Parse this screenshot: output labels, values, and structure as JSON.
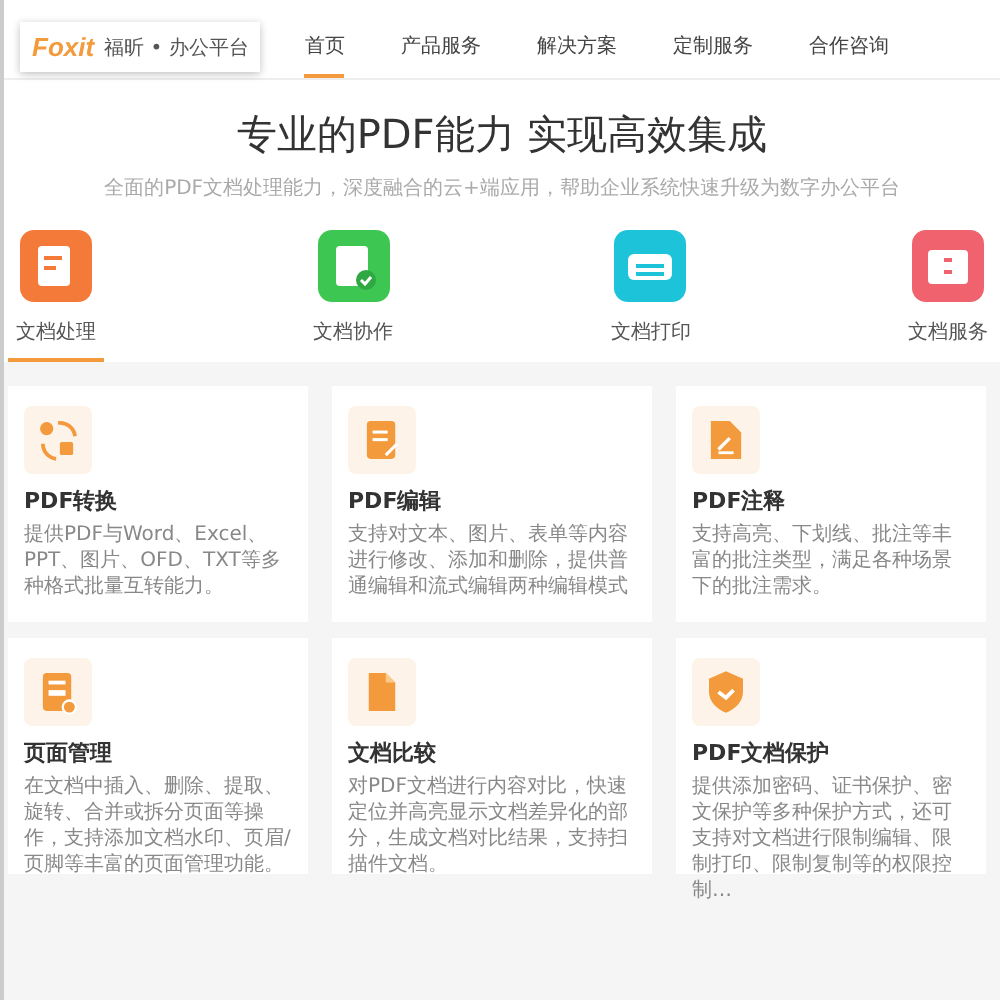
{
  "header": {
    "logo": "Foxit",
    "brand": "福昕 • 办公平台",
    "nav": [
      {
        "label": "首页",
        "selected": true
      },
      {
        "label": "产品服务",
        "selected": false
      },
      {
        "label": "解决方案",
        "selected": false
      },
      {
        "label": "定制服务",
        "selected": false
      },
      {
        "label": "合作咨询",
        "selected": false
      }
    ]
  },
  "hero": {
    "title": "专业的PDF能力 实现高效集成",
    "subtitle": "全面的PDF文档处理能力，深度融合的云+端应用，帮助企业系统快速升级为数字办公平台"
  },
  "tabs": [
    {
      "label": "文档处理",
      "selected": true,
      "color": "#f47a3a"
    },
    {
      "label": "文档协作",
      "selected": false,
      "color": "#3ec653"
    },
    {
      "label": "文档打印",
      "selected": false,
      "color": "#1cc3d9"
    },
    {
      "label": "文档服务",
      "selected": false,
      "color": "#f0636e"
    }
  ],
  "cards": [
    {
      "title": "PDF转换",
      "description": "提供PDF与Word、Excel、PPT、图片、OFD、TXT等多种格式批量互转能力。"
    },
    {
      "title": "PDF编辑",
      "description": "支持对文本、图片、表单等内容进行修改、添加和删除，提供普通编辑和流式编辑两种编辑模式"
    },
    {
      "title": "PDF注释",
      "description": "支持高亮、下划线、批注等丰富的批注类型，满足各种场景下的批注需求。"
    },
    {
      "title": "页面管理",
      "description": "在文档中插入、删除、提取、旋转、合并或拆分页面等操作，支持添加文档水印、页眉/页脚等丰富的页面管理功能。"
    },
    {
      "title": "文档比较",
      "description": "对PDF文档进行内容对比，快速定位并高亮显示文档差异化的部分，生成文档对比结果，支持扫描件文档。"
    },
    {
      "title": "PDF文档保护",
      "description": "提供添加密码、证书保护、密文保护等多种保护方式，还可支持对文档进行限制编辑、限制打印、限制复制等的权限控制…"
    }
  ]
}
